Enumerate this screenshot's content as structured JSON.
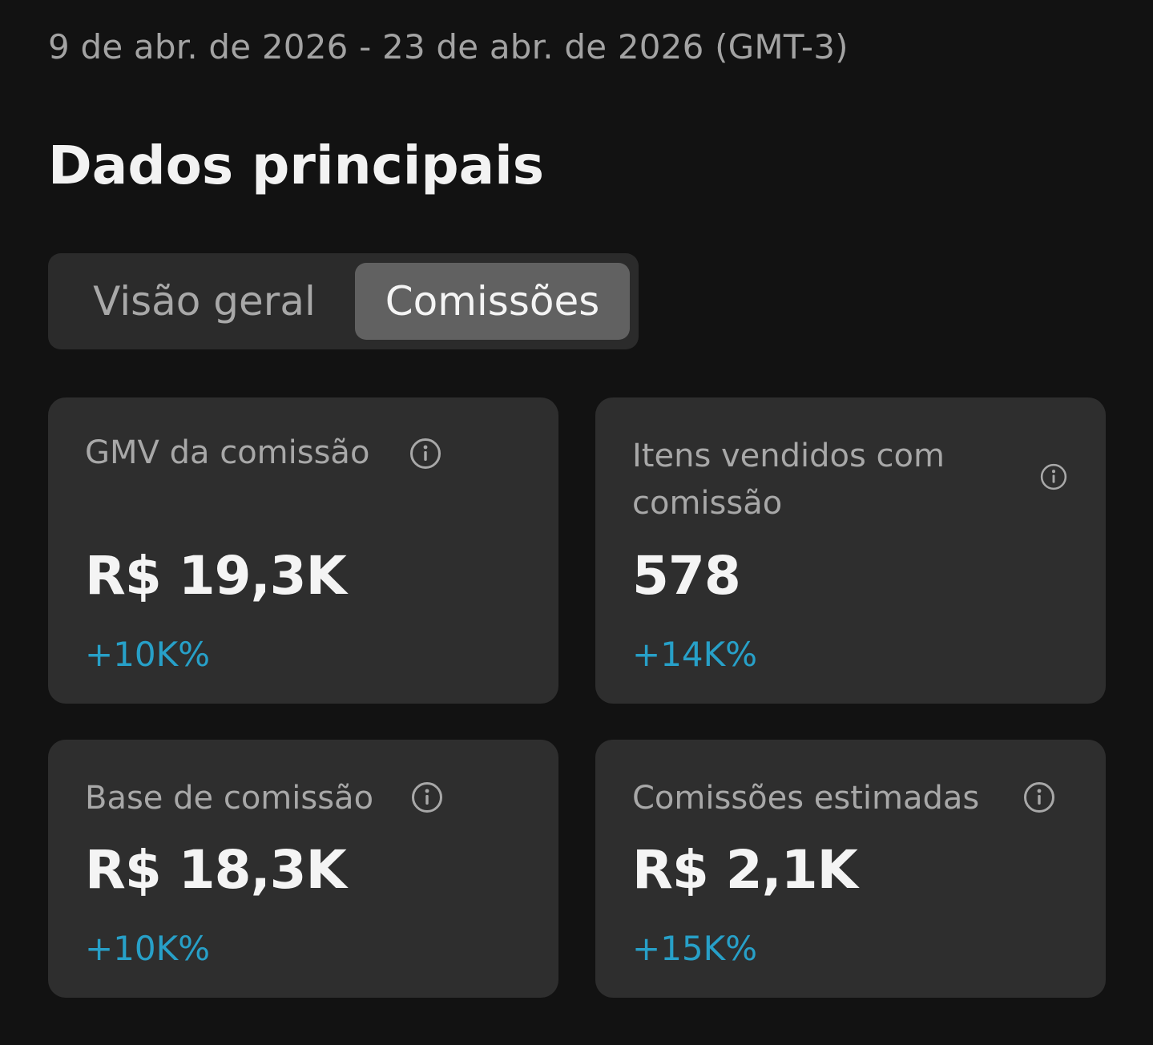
{
  "header": {
    "date_range": "9 de abr. de 2026 - 23 de abr. de 2026 (GMT-3)",
    "section_title": "Dados principais"
  },
  "tabs": [
    {
      "label": "Visão geral",
      "selected": false
    },
    {
      "label": "Comissões",
      "selected": true
    }
  ],
  "metrics": [
    {
      "label": "GMV da comissão",
      "value": "R$ 19,3K",
      "change": "+10K%",
      "icon": "info-icon"
    },
    {
      "label": "Itens vendidos com comissão",
      "value": "578",
      "change": "+14K%",
      "icon": "info-icon"
    },
    {
      "label": "Base de comissão",
      "value": "R$ 18,3K",
      "change": "+10K%",
      "icon": "info-icon"
    },
    {
      "label": "Comissões estimadas",
      "value": "R$ 2,1K",
      "change": "+15K%",
      "icon": "info-icon"
    }
  ],
  "colors": {
    "background": "#121212",
    "card": "#2e2e2e",
    "selected_tab": "#616161",
    "positive_change": "#27a0c8"
  }
}
